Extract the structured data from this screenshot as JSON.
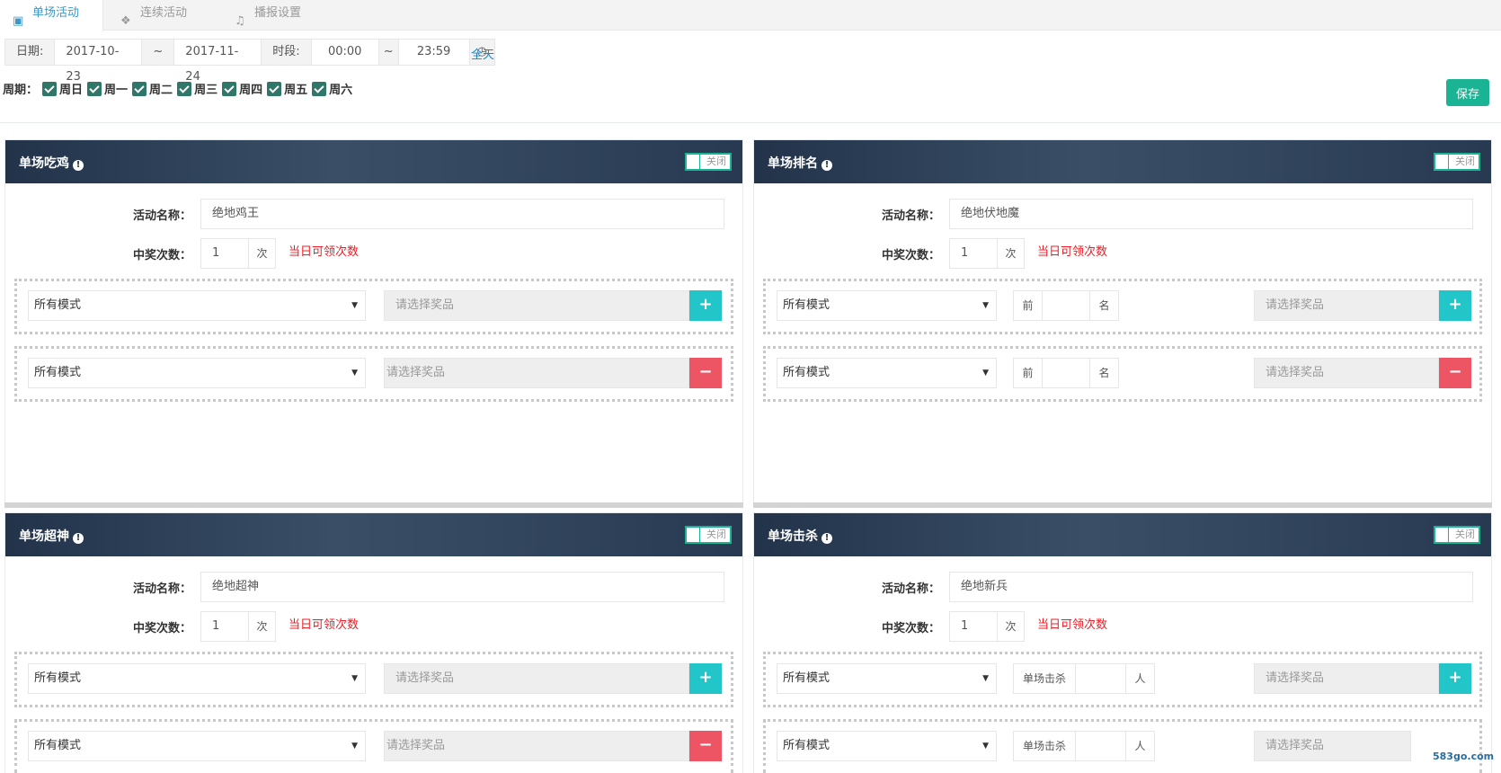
{
  "tabs": [
    {
      "label": "单场活动",
      "icon": "cube-icon"
    },
    {
      "label": "连续活动",
      "icon": "cubes-icon"
    },
    {
      "label": "播报设置",
      "icon": "bell-icon"
    }
  ],
  "filter": {
    "date_label": "日期:",
    "date_start": "2017-10-23",
    "tilde": "~",
    "date_end": "2017-11-24",
    "time_label": "时段:",
    "time_start": "00:00",
    "time_end": "23:59",
    "allday": "全天"
  },
  "week": {
    "label": "周期：",
    "days": [
      "周日",
      "周一",
      "周二",
      "周三",
      "周四",
      "周五",
      "周六"
    ]
  },
  "save_label": "保存",
  "panels": [
    {
      "title": "单场吃鸡",
      "toggle": "关闭",
      "name_label": "活动名称：",
      "name_value": "绝地鸡王",
      "count_label": "中奖次数：",
      "count_value": "1",
      "count_unit": "次",
      "hint": "当日可领次数",
      "rows": [
        {
          "mode": "所有模式",
          "prize_ph": "请选择奖品"
        },
        {
          "mode": "所有模式",
          "prize_ph": "请选择奖品"
        }
      ]
    },
    {
      "title": "单场排名",
      "toggle": "关闭",
      "name_label": "活动名称：",
      "name_value": "绝地伏地魔",
      "count_label": "中奖次数：",
      "count_value": "1",
      "count_unit": "次",
      "hint": "当日可领次数",
      "rows": [
        {
          "mode": "所有模式",
          "pre": "前",
          "post": "名",
          "prize_ph": "请选择奖品"
        },
        {
          "mode": "所有模式",
          "pre": "前",
          "post": "名",
          "prize_ph": "请选择奖品"
        }
      ]
    },
    {
      "title": "单场超神",
      "toggle": "关闭",
      "name_label": "活动名称：",
      "name_value": "绝地超神",
      "count_label": "中奖次数：",
      "count_value": "1",
      "count_unit": "次",
      "hint": "当日可领次数",
      "rows": [
        {
          "mode": "所有模式",
          "prize_ph": "请选择奖品"
        },
        {
          "mode": "所有模式",
          "prize_ph": "请选择奖品"
        }
      ]
    },
    {
      "title": "单场击杀",
      "toggle": "关闭",
      "name_label": "活动名称：",
      "name_value": "绝地新兵",
      "count_label": "中奖次数：",
      "count_value": "1",
      "count_unit": "次",
      "hint": "当日可领次数",
      "rows": [
        {
          "mode": "所有模式",
          "pre": "单场击杀",
          "post": "人",
          "prize_ph": "请选择奖品"
        },
        {
          "mode": "所有模式",
          "pre": "单场击杀",
          "post": "人",
          "prize_ph": "请选择奖品"
        }
      ]
    }
  ],
  "watermark": "583go.com"
}
